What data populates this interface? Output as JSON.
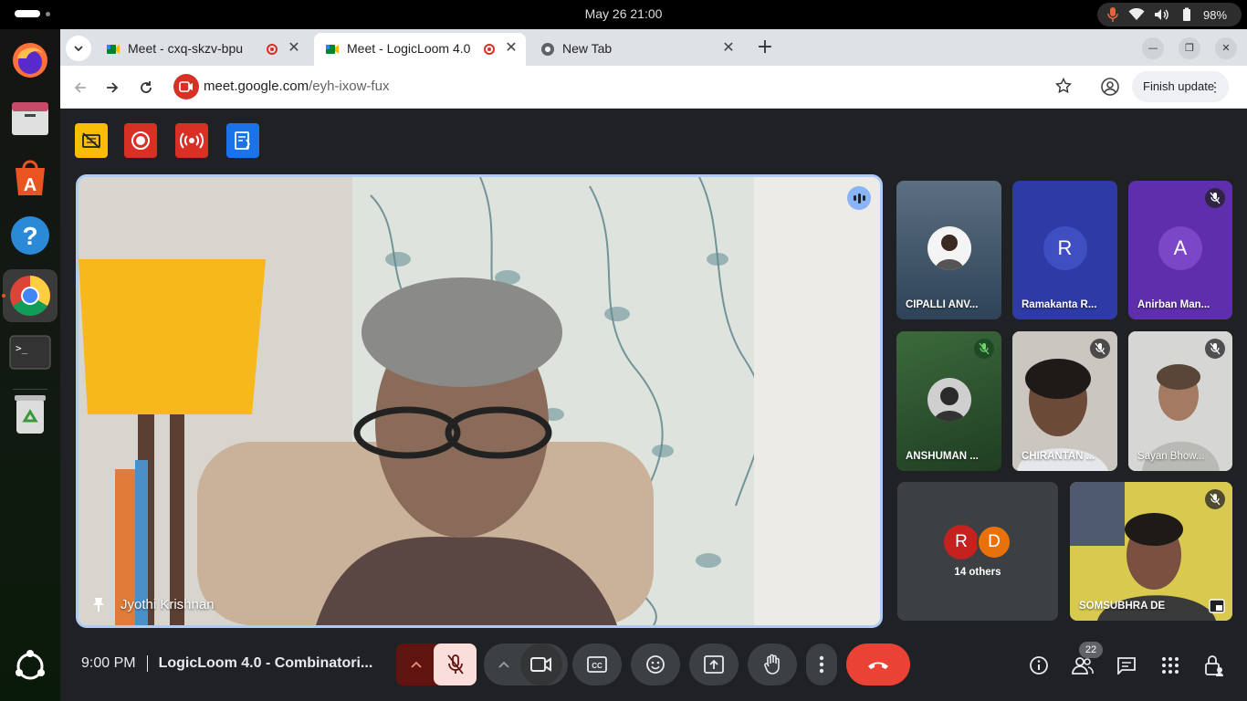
{
  "system": {
    "clock": "May 26  21:00",
    "battery": "98%"
  },
  "browser": {
    "tabs": [
      {
        "title": "Meet - cxq-skzv-bpu",
        "recording": true
      },
      {
        "title": "Meet - LogicLoom 4.0",
        "recording": true,
        "active": true
      },
      {
        "title": "New Tab",
        "recording": false
      }
    ],
    "url_host": "meet.google.com",
    "url_path": "/eyh-ixow-fux",
    "finish_update": "Finish update"
  },
  "meet": {
    "presenter": {
      "name": "Jyothi Krishnan",
      "speaking": true
    },
    "participants": [
      {
        "name": "CIPALLI ANV...",
        "type": "photo",
        "muted": false
      },
      {
        "name": "Ramakanta R...",
        "type": "letter",
        "letter": "R",
        "muted": false
      },
      {
        "name": "Anirban Man...",
        "type": "letter",
        "letter": "A",
        "muted": true
      },
      {
        "name": "ANSHUMAN ...",
        "type": "photo",
        "muted": true
      },
      {
        "name": "CHIRANTAN ...",
        "type": "video",
        "muted": true
      },
      {
        "name": "Sayan Bhow...",
        "type": "video",
        "muted": true
      },
      {
        "name": "SOMSUBHRA DE",
        "type": "video",
        "muted": true
      }
    ],
    "others": {
      "avatars": [
        "R",
        "D"
      ],
      "label": "14 others"
    },
    "time": "9:00 PM",
    "meeting_name": "LogicLoom 4.0 - Combinatori...",
    "people_count": "22",
    "colors": {
      "accent_blue": "#8ab4f8",
      "end_call_red": "#ea4335",
      "meet_bg": "#202124"
    }
  }
}
